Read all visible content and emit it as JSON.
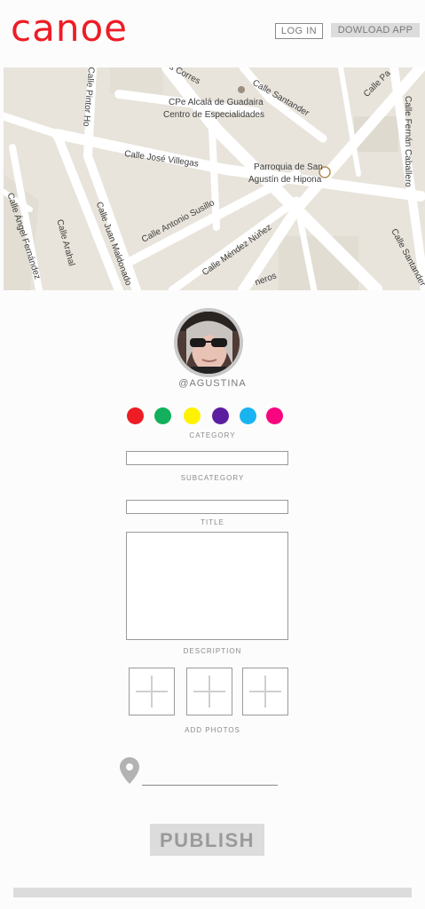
{
  "header": {
    "logo_text": "canoe",
    "login_label": "LOG IN",
    "download_label": "DOWLOAD APP",
    "brand_color": "#ee1c25"
  },
  "map": {
    "labels": [
      "s Corres",
      "Calle Santander",
      "Calle Pa",
      "Calle Fernán Caballero",
      "CPe Alcalá de Guadaira",
      "Centro de Especialidades",
      "Calle Pintor Ho",
      "Calle José Villegas",
      "Parroquia de San",
      "Agustín de Hipona",
      "Calle Antonio Susillo",
      "Calle Méndez Núñez",
      "Calle Juan Maldonado",
      "Calle Arahal",
      "Calle Ángel Fernández",
      "Calle Santander",
      "neros"
    ]
  },
  "profile": {
    "username": "@AGUSTINA"
  },
  "category": {
    "label": "CATEGORY",
    "colors": [
      "#ee1c25",
      "#12b05a",
      "#fff200",
      "#5c1ea0",
      "#19b4f0",
      "#f7067f"
    ]
  },
  "form": {
    "subcategory_label": "SUBCATEGORY",
    "subcategory_value": "",
    "title_label": "TITLE",
    "title_value": "",
    "description_label": "DESCRIPTION",
    "description_value": "",
    "photos_label": "ADD PHOTOS",
    "location_value": ""
  },
  "actions": {
    "publish_label": "PUBLISH"
  },
  "icons": {
    "pin": "location-pin-icon",
    "add_photo": "plus-icon"
  }
}
